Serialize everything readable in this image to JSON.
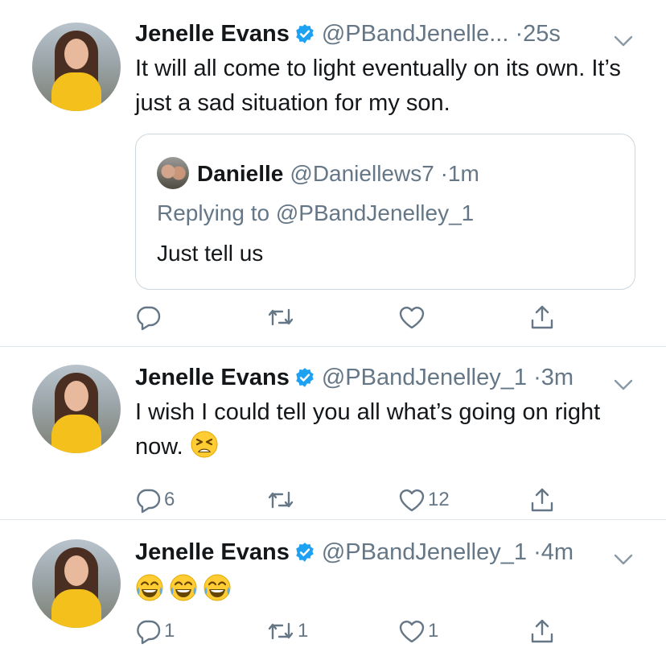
{
  "colors": {
    "accent": "#1da1f2",
    "muted": "#657786",
    "text": "#14171a",
    "divider": "#e1e8ed"
  },
  "icons": {
    "reply": "reply-bubble-icon",
    "retweet": "retweet-icon",
    "like": "heart-icon",
    "share": "share-upload-icon",
    "verified": "verified-badge-icon",
    "more": "chevron-down-icon"
  },
  "tweets": [
    {
      "name": "Jenelle Evans",
      "handle": "@PBandJenelle...",
      "dot": "·",
      "time": "25s",
      "text": "It will all come to light eventually on its own. It’s just a sad situation for my son.",
      "quote": {
        "name": "Danielle",
        "handle": "@Daniellews7",
        "dot": "·",
        "time": "1m",
        "reply_prefix": "Replying to",
        "reply_to": "@PBandJenelley_1",
        "text": "Just tell us"
      },
      "counts": {
        "reply": "",
        "retweet": "",
        "like": ""
      }
    },
    {
      "name": "Jenelle Evans",
      "handle": "@PBandJenelley_1",
      "dot": "·",
      "time": "3m",
      "text": "I wish I could tell you all what’s going on right now.",
      "emoji": "tired-face",
      "counts": {
        "reply": "6",
        "retweet": "",
        "like": "12"
      }
    },
    {
      "name": "Jenelle Evans",
      "handle": "@PBandJenelley_1",
      "dot": "·",
      "time": "4m",
      "emojis": [
        "tears-of-joy",
        "tears-of-joy",
        "tears-of-joy"
      ],
      "counts": {
        "reply": "1",
        "retweet": "1",
        "like": "1"
      }
    }
  ]
}
